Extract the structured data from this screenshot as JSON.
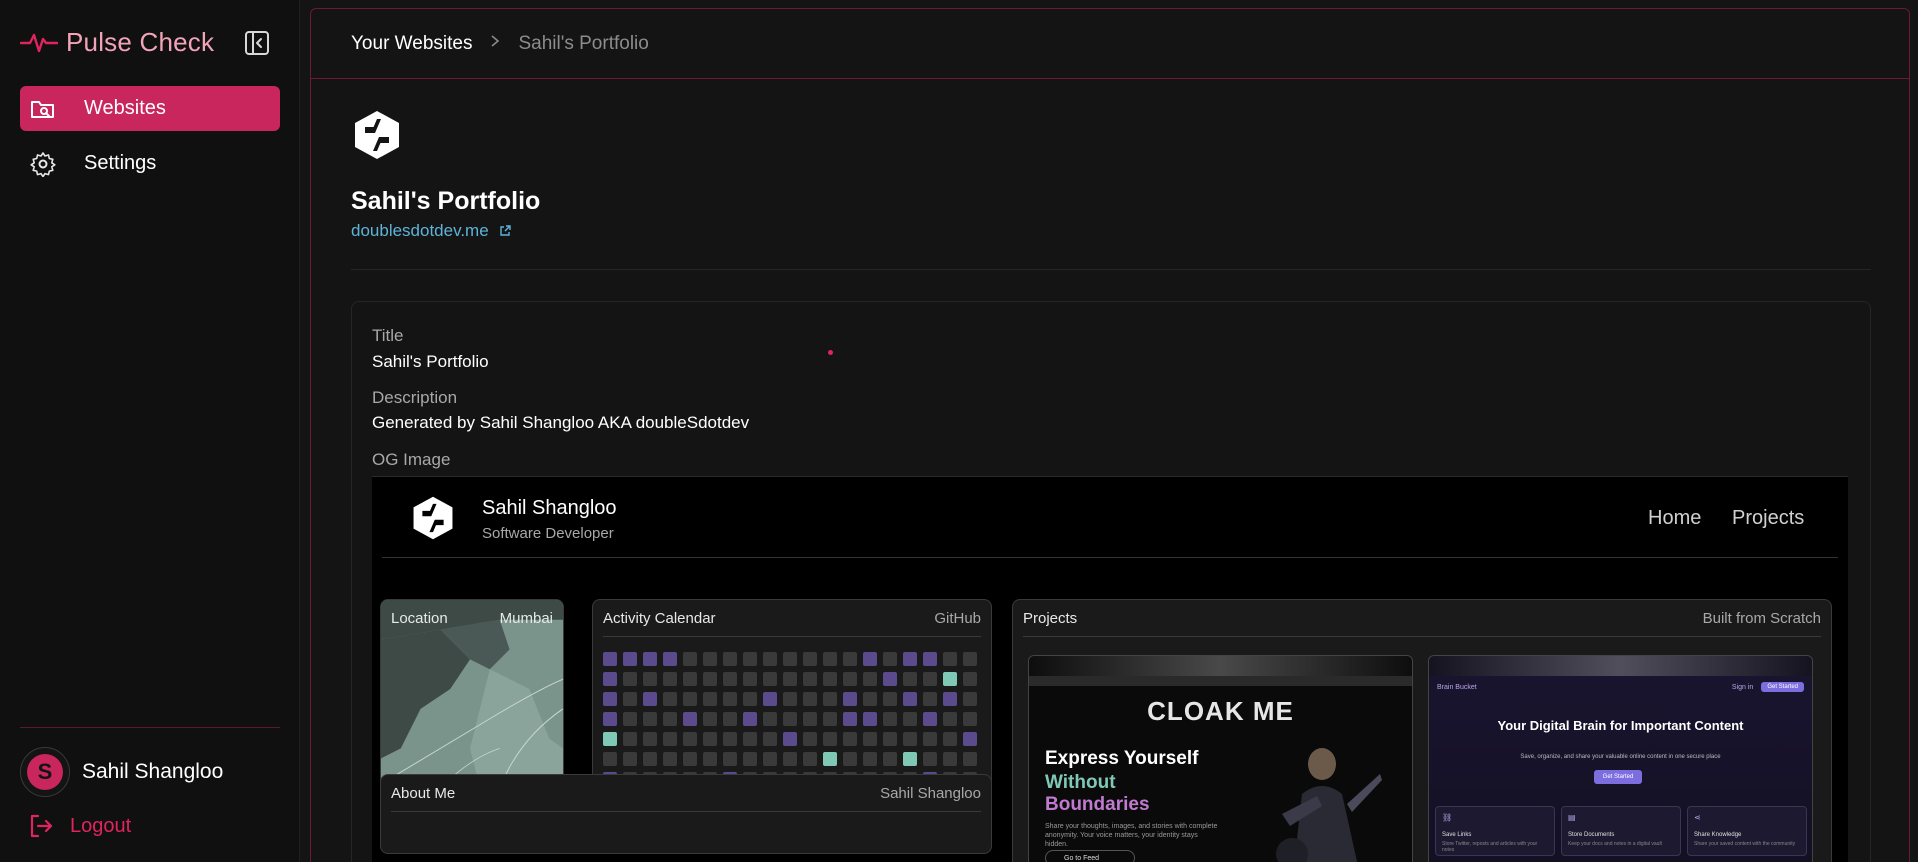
{
  "app": {
    "name": "Pulse Check",
    "accent": "#c8265c",
    "brand_color": "#f2a3b8"
  },
  "sidebar": {
    "items": [
      {
        "label": "Websites",
        "icon": "folder-search-icon",
        "active": true
      },
      {
        "label": "Settings",
        "icon": "gear-icon",
        "active": false
      }
    ],
    "user": {
      "initial": "S",
      "name": "Sahil Shangloo"
    },
    "logout_label": "Logout"
  },
  "breadcrumb": {
    "root": "Your Websites",
    "current": "Sahil's Portfolio"
  },
  "site": {
    "title": "Sahil's Portfolio",
    "url": "doublesdotdev.me"
  },
  "details": {
    "title_label": "Title",
    "title_value": "Sahil's Portfolio",
    "description_label": "Description",
    "description_value": "Generated by Sahil Shangloo AKA doubleSdotdev",
    "og_label": "OG Image"
  },
  "og_image": {
    "name": "Sahil Shangloo",
    "role": "Software Developer",
    "nav": [
      "Home",
      "Projects"
    ],
    "location_label": "Location",
    "location_value": "Mumbai",
    "activity_label": "Activity Calendar",
    "activity_source": "GitHub",
    "projects_label": "Projects",
    "projects_note": "Built from Scratch",
    "about_label": "About Me",
    "about_name": "Sahil Shangloo",
    "project_a": {
      "title": "CLOAK ME",
      "line1": "Express Yourself",
      "line2": "Without",
      "line3": "Boundaries",
      "blurb": "Share your thoughts, images, and stories with complete anonymity. Your voice matters, your identity stays hidden.",
      "cta": "Go to Feed"
    },
    "project_b": {
      "brand": "Brain Bucket",
      "signin": "Sign in",
      "top_cta": "Get Started",
      "title": "Your Digital Brain for Important Content",
      "subtitle": "Save, organize, and share your valuable online content in one secure place",
      "cta": "Get Started",
      "cards": [
        {
          "title": "Save Links",
          "desc": "Store Twitter, reposts and articles with your notes"
        },
        {
          "title": "Store Documents",
          "desc": "Keep your docs and notes in a digital vault"
        },
        {
          "title": "Share Knowledge",
          "desc": "Share your saved content with the community"
        }
      ]
    }
  }
}
